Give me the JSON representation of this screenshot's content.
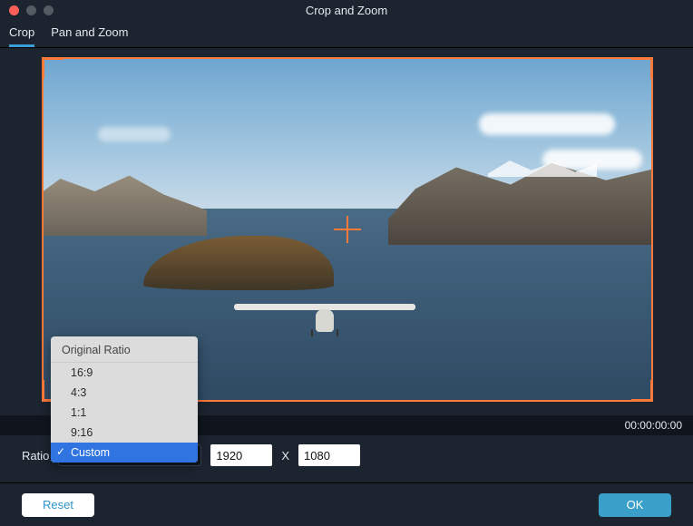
{
  "window": {
    "title": "Crop and Zoom"
  },
  "tabs": {
    "crop": "Crop",
    "panzoom": "Pan and Zoom"
  },
  "timecode": "00:00:00:00",
  "ratio": {
    "label": "Ratio",
    "dropdown_header": "Original Ratio",
    "options": [
      "16:9",
      "4:3",
      "1:1",
      "9:16",
      "Custom"
    ],
    "selected": "Custom"
  },
  "dimensions": {
    "width": "1920",
    "sep": "X",
    "height": "1080"
  },
  "buttons": {
    "reset": "Reset",
    "ok": "OK"
  }
}
